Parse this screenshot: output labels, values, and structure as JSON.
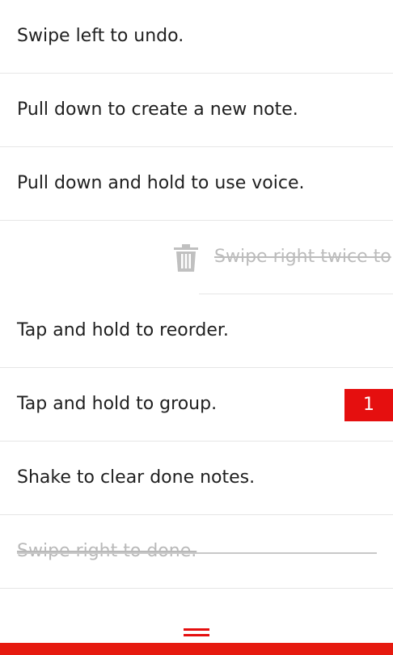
{
  "notes": [
    {
      "label": "Swipe left to undo."
    },
    {
      "label": "Pull down to create a new note."
    },
    {
      "label": "Pull down and hold to use voice."
    },
    {
      "label": "Swipe right twice to"
    },
    {
      "label": "Tap and hold to reorder."
    },
    {
      "label": "Tap and hold to group.",
      "badge": "1"
    },
    {
      "label": "Shake to clear done notes."
    },
    {
      "label": "Swipe right to done."
    }
  ],
  "colors": {
    "accent": "#e50f0f",
    "done_text": "#b9b9b9",
    "divider": "#e6e6e6"
  },
  "icons": {
    "delete": "trash-icon",
    "menu": "drag-handle-icon"
  }
}
